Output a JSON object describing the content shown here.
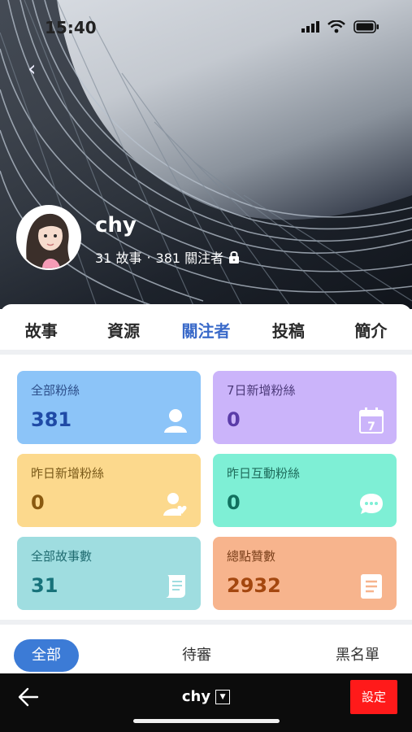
{
  "status_bar": {
    "time": "15:40"
  },
  "profile": {
    "name": "chy",
    "stories": "31 故事",
    "separator": "·",
    "followers": "381 關注者"
  },
  "tabs": [
    {
      "label": "故事"
    },
    {
      "label": "資源"
    },
    {
      "label": "關注者",
      "active": true
    },
    {
      "label": "投稿"
    },
    {
      "label": "簡介"
    }
  ],
  "stats": [
    {
      "label": "全部粉絲",
      "value": "381",
      "icon": "person-icon",
      "bg": "#8cc4f8",
      "label_color": "#2d4f8a",
      "value_color": "#1f4aa6"
    },
    {
      "label": "7日新增粉絲",
      "value": "0",
      "icon": "calendar-icon",
      "bg": "#cbb4fa",
      "label_color": "#4c3a7a",
      "value_color": "#5a3ca8"
    },
    {
      "label": "昨日新增粉絲",
      "value": "0",
      "icon": "add-person-icon",
      "bg": "#fcd98d",
      "label_color": "#7a5a1a",
      "value_color": "#8a5a10"
    },
    {
      "label": "昨日互動粉絲",
      "value": "0",
      "icon": "chat-icon",
      "bg": "#7eefd5",
      "label_color": "#1e6b5b",
      "value_color": "#11715f"
    },
    {
      "label": "全部故事數",
      "value": "31",
      "icon": "scroll-icon",
      "bg": "#9fdde0",
      "label_color": "#1f6b70",
      "value_color": "#17727a"
    },
    {
      "label": "總點贊數",
      "value": "2932",
      "icon": "document-icon",
      "bg": "#f7b48d",
      "label_color": "#7a3f1a",
      "value_color": "#a4470f"
    }
  ],
  "filters": {
    "all": "全部",
    "pending": "待審",
    "blacklist": "黑名單"
  },
  "bottom_bar": {
    "title": "chy",
    "settings": "設定"
  },
  "colors": {
    "accent": "#3a6ac9",
    "pill": "#3c7bd6",
    "settings_red": "#ff1a1a"
  }
}
